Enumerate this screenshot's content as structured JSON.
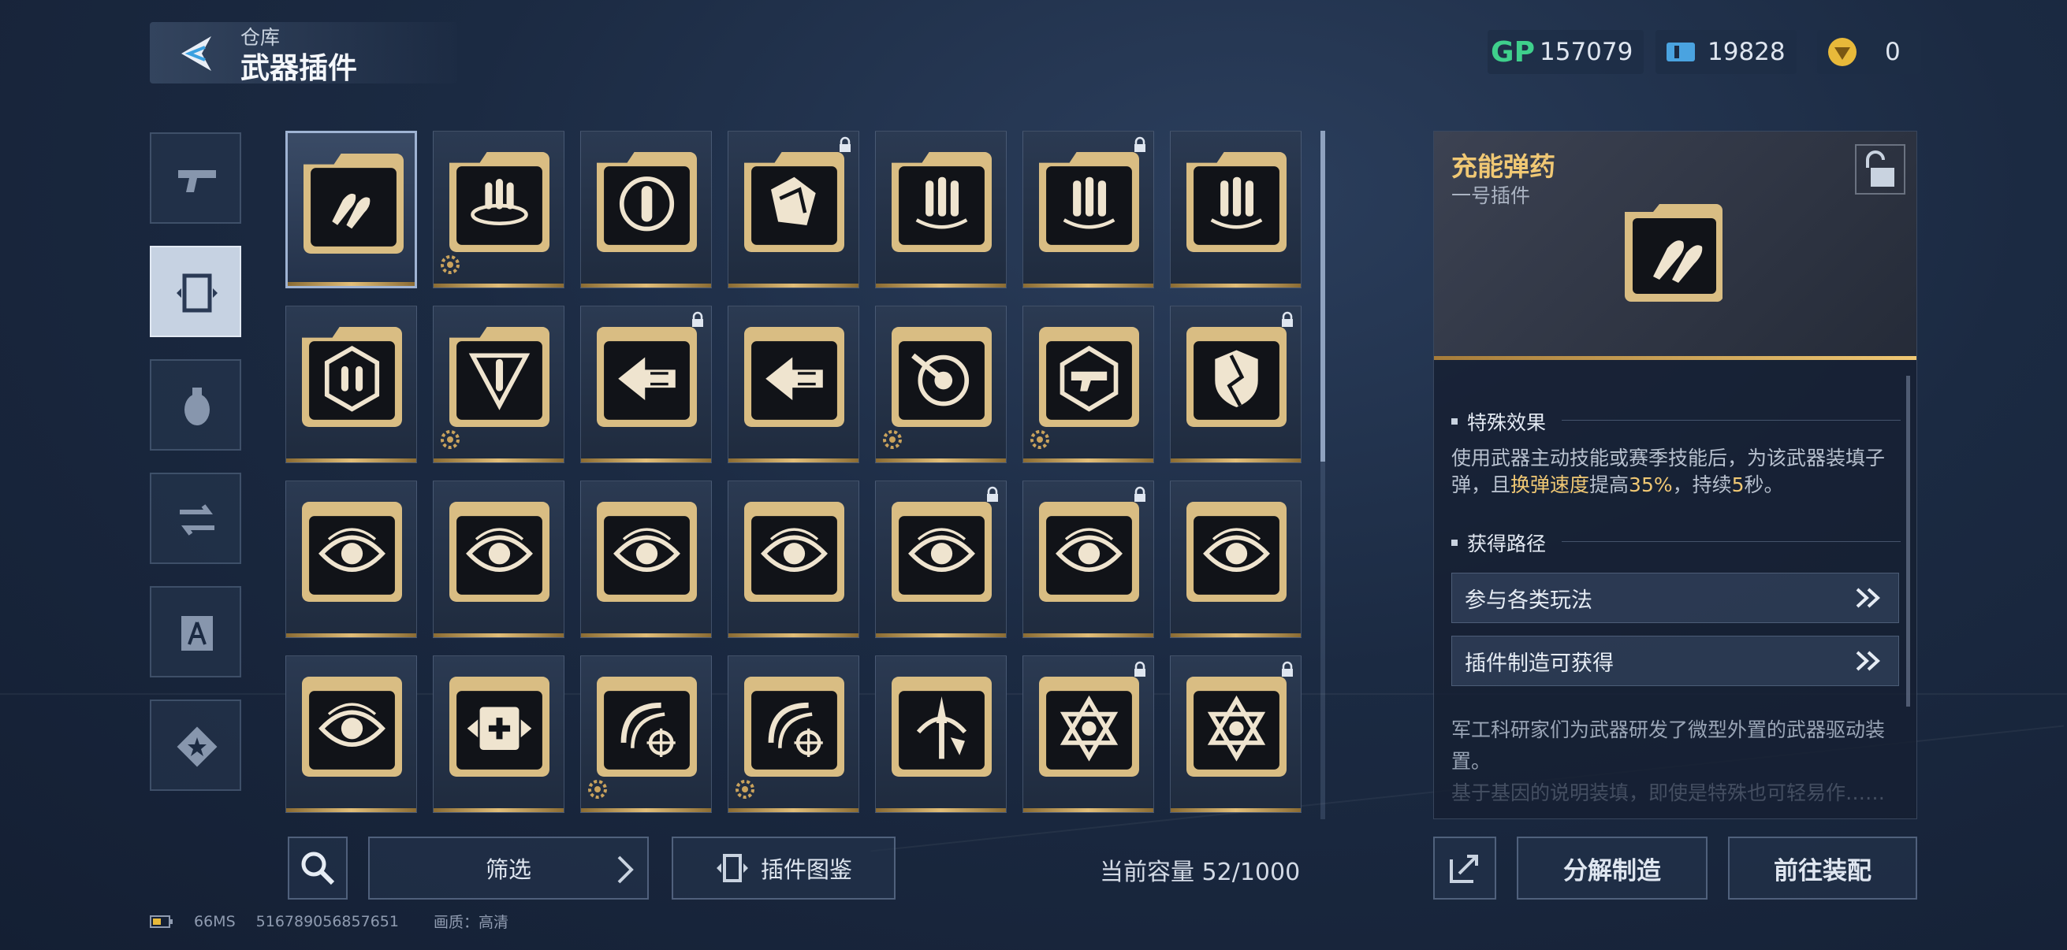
{
  "header": {
    "breadcrumb": "仓库",
    "title": "武器插件"
  },
  "currencies": [
    {
      "icon": "gp-coin-icon",
      "value": "157079",
      "color": "#3fd08c"
    },
    {
      "icon": "ticket-icon",
      "value": "19828",
      "color": "#4aa3e0"
    },
    {
      "icon": "gold-medal-icon",
      "value": "0",
      "color": "#e8b93a"
    }
  ],
  "categories": [
    {
      "name": "pistol-icon",
      "active": false
    },
    {
      "name": "plugin-card-icon",
      "active": true
    },
    {
      "name": "grenade-icon",
      "active": false
    },
    {
      "name": "transfer-icon",
      "active": false
    },
    {
      "name": "character-icon",
      "active": false
    },
    {
      "name": "star-badge-icon",
      "active": false
    }
  ],
  "plugins": [
    {
      "icon": "rocket-bullets-icon",
      "type": "folder",
      "lock": false,
      "gear": false,
      "selected": true
    },
    {
      "icon": "bullet-ring-icon",
      "type": "folder",
      "lock": false,
      "gear": true,
      "selected": false
    },
    {
      "icon": "bullet-orbit-icon",
      "type": "folder",
      "lock": false,
      "gear": false,
      "selected": false
    },
    {
      "icon": "shattered-bullet-icon",
      "type": "folder",
      "lock": true,
      "gear": false,
      "selected": false
    },
    {
      "icon": "triple-bullet-icon",
      "type": "folder",
      "lock": false,
      "gear": false,
      "selected": false
    },
    {
      "icon": "triple-bullet-icon",
      "type": "folder",
      "lock": true,
      "gear": false,
      "selected": false
    },
    {
      "icon": "triple-bullet-icon",
      "type": "folder",
      "lock": false,
      "gear": false,
      "selected": false
    },
    {
      "icon": "bullet-cycle-icon",
      "type": "folder",
      "lock": false,
      "gear": false,
      "selected": false
    },
    {
      "icon": "chevron-bullet-icon",
      "type": "folder",
      "lock": false,
      "gear": true,
      "selected": false
    },
    {
      "icon": "dash-arrow-icon",
      "type": "card",
      "lock": true,
      "gear": false,
      "selected": false
    },
    {
      "icon": "dash-arrow-icon",
      "type": "card",
      "lock": false,
      "gear": false,
      "selected": false
    },
    {
      "icon": "target-arrow-icon",
      "type": "card",
      "lock": false,
      "gear": true,
      "selected": false
    },
    {
      "icon": "gun-hex-icon",
      "type": "card",
      "lock": false,
      "gear": true,
      "selected": false
    },
    {
      "icon": "broken-shield-icon",
      "type": "card",
      "lock": true,
      "gear": false,
      "selected": false
    },
    {
      "icon": "eye-icon",
      "type": "card",
      "lock": false,
      "gear": false,
      "selected": false
    },
    {
      "icon": "eye-icon",
      "type": "card",
      "lock": false,
      "gear": false,
      "selected": false
    },
    {
      "icon": "eye-icon",
      "type": "card",
      "lock": false,
      "gear": false,
      "selected": false
    },
    {
      "icon": "eye-icon",
      "type": "card",
      "lock": false,
      "gear": false,
      "selected": false
    },
    {
      "icon": "eye-icon",
      "type": "card",
      "lock": true,
      "gear": false,
      "selected": false
    },
    {
      "icon": "eye-icon",
      "type": "card",
      "lock": true,
      "gear": false,
      "selected": false
    },
    {
      "icon": "eye-icon",
      "type": "card",
      "lock": false,
      "gear": false,
      "selected": false
    },
    {
      "icon": "eye-icon",
      "type": "card",
      "lock": false,
      "gear": false,
      "selected": false
    },
    {
      "icon": "medkit-icon",
      "type": "card",
      "lock": false,
      "gear": false,
      "selected": false
    },
    {
      "icon": "crosshair-swirl-icon",
      "type": "card",
      "lock": false,
      "gear": true,
      "selected": false
    },
    {
      "icon": "crosshair-swirl-icon",
      "type": "card",
      "lock": false,
      "gear": true,
      "selected": false
    },
    {
      "icon": "shield-spear-icon",
      "type": "card",
      "lock": false,
      "gear": false,
      "selected": false
    },
    {
      "icon": "hexagram-icon",
      "type": "card",
      "lock": true,
      "gear": false,
      "selected": false
    },
    {
      "icon": "hexagram-icon",
      "type": "card",
      "lock": true,
      "gear": false,
      "selected": false
    }
  ],
  "toolbar": {
    "filter_label": "筛选",
    "codex_label": "插件图鉴",
    "capacity": "当前容量 52/1000"
  },
  "footer": {
    "latency": "66MS",
    "uid": "516789056857651",
    "quality": "画质：高清"
  },
  "detail": {
    "name": "充能弹药",
    "slot": "一号插件",
    "effect_title": "特殊效果",
    "effect_parts": [
      "使用武器主动技能或赛季技能后，为该武器装填子弹，且",
      "换弹速度",
      "提高",
      "35%",
      "，持续",
      "5",
      "秒。"
    ],
    "source_title": "获得路径",
    "sources": [
      "参与各类玩法",
      "插件制造可获得"
    ],
    "lore": "军工科研家们为武器研发了微型外置的武器驱动装置。",
    "lore_faded": "基于基因的说明装填，即使是特殊也可轻易作……"
  },
  "actions": {
    "decompose_label": "分解制造",
    "equip_label": "前往装配"
  },
  "colors": {
    "gold": "#f0c874",
    "panel": "#161f30"
  }
}
